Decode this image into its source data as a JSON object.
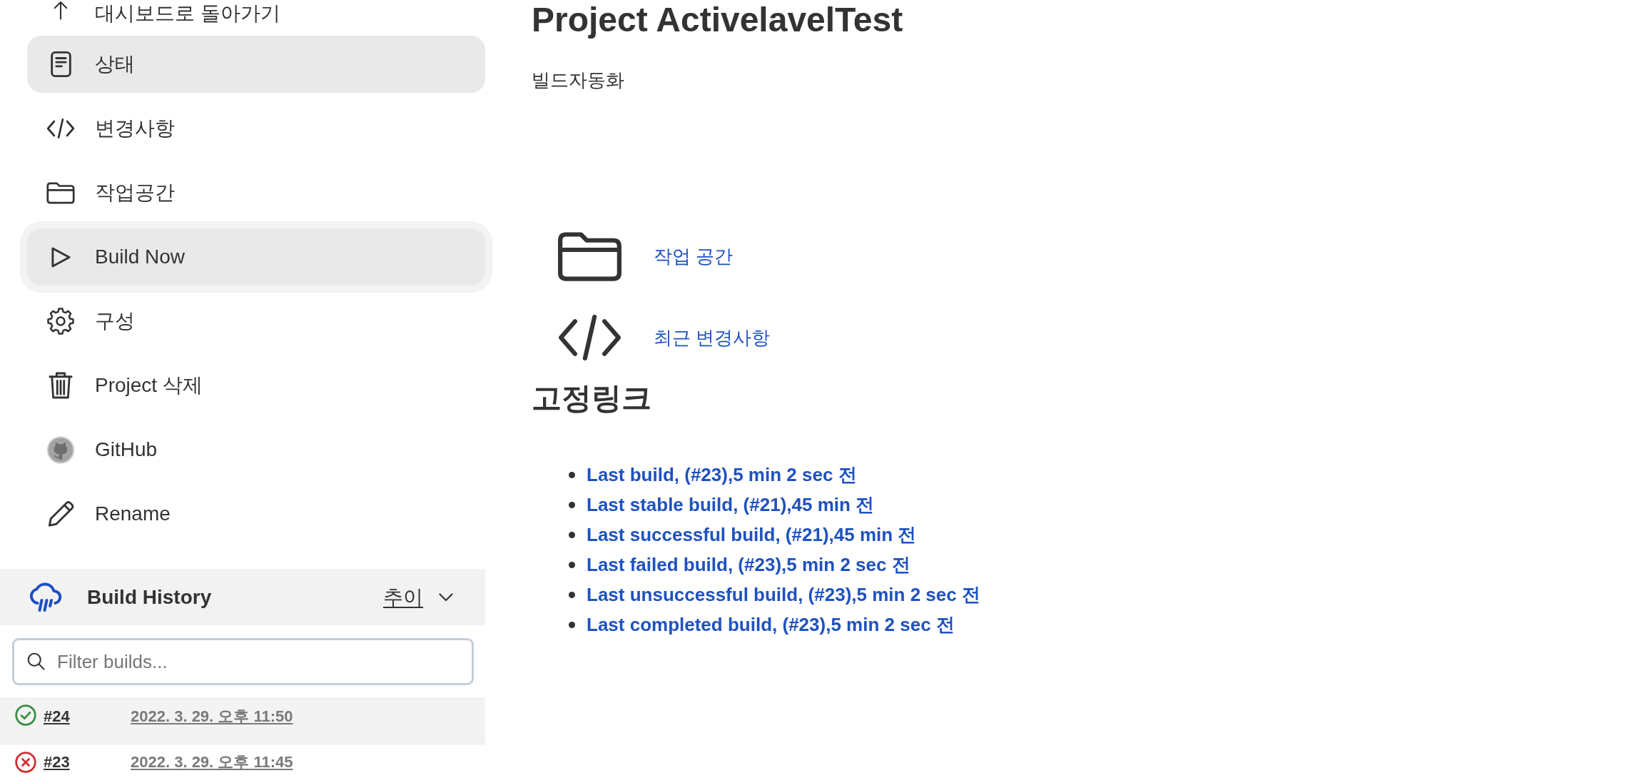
{
  "sidebar": {
    "items": [
      {
        "label": "대시보드로 돌아가기",
        "selected": false,
        "focused": false
      },
      {
        "label": "상태",
        "selected": true,
        "focused": false
      },
      {
        "label": "변경사항",
        "selected": false,
        "focused": false
      },
      {
        "label": "작업공간",
        "selected": false,
        "focused": false
      },
      {
        "label": "Build Now",
        "selected": false,
        "focused": true
      },
      {
        "label": "구성",
        "selected": false,
        "focused": false
      },
      {
        "label": "Project 삭제",
        "selected": false,
        "focused": false
      },
      {
        "label": "GitHub",
        "selected": false,
        "focused": false
      },
      {
        "label": "Rename",
        "selected": false,
        "focused": false
      }
    ]
  },
  "build_history": {
    "title": "Build History",
    "trend_link": "추이",
    "filter": {
      "placeholder": "Filter builds..."
    },
    "builds": [
      {
        "number": "#24",
        "time": "2022. 3. 29. 오후 11:50",
        "kind": "success",
        "highlighted": true
      },
      {
        "number": "#23",
        "time": "2022. 3. 29. 오후 11:45",
        "kind": "failure",
        "highlighted": false
      }
    ]
  },
  "main": {
    "title": "Project ActivelavelTest",
    "description": "빌드자동화",
    "links": [
      "작업 공간",
      "최근 변경사항"
    ],
    "permalinks_heading": "고정링크",
    "permalinks": [
      "Last build, (#23),5 min 2 sec 전",
      "Last stable build, (#21),45 min 전",
      "Last successful build, (#21),45 min 전",
      "Last failed build, (#23),5 min 2 sec 전",
      "Last unsuccessful build, (#23),5 min 2 sec 전",
      "Last completed build, (#23),5 min 2 sec 전"
    ]
  }
}
